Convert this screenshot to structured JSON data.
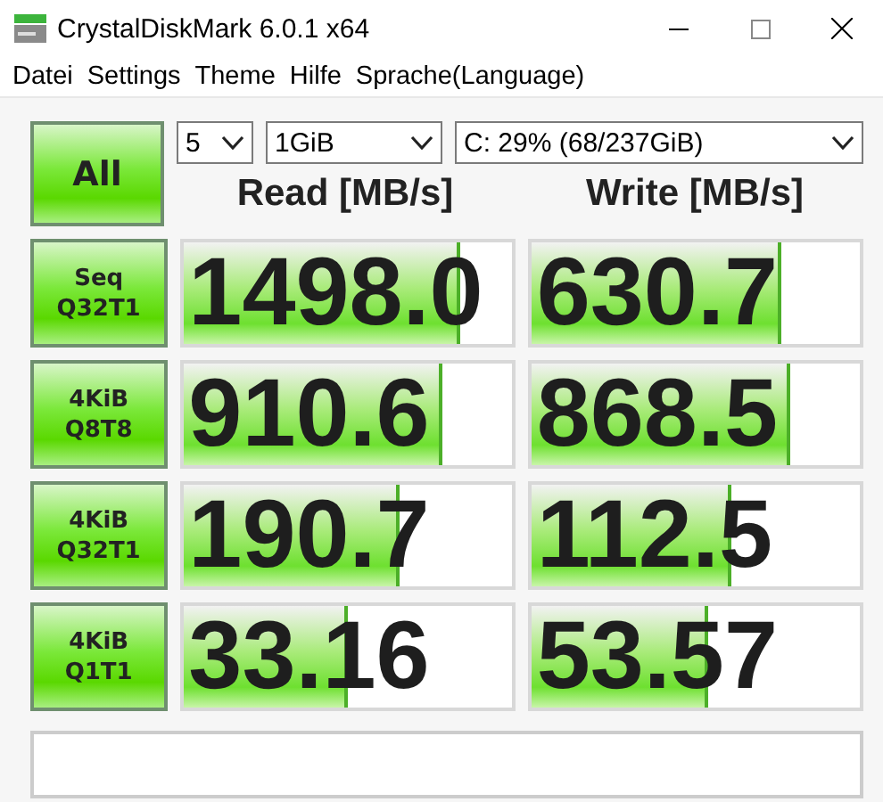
{
  "window": {
    "title": "CrystalDiskMark 6.0.1 x64"
  },
  "menu": [
    "Datei",
    "Settings",
    "Theme",
    "Hilfe",
    "Sprache(Language)"
  ],
  "all_button": {
    "label": "All"
  },
  "selects": [
    {
      "value": "5"
    },
    {
      "value": "1GiB"
    },
    {
      "value": "C: 29% (68/237GiB)"
    }
  ],
  "columns": [
    "Read [MB/s]",
    "Write [MB/s]"
  ],
  "rows": [
    {
      "test": [
        "Seq",
        "Q32T1"
      ],
      "read": {
        "value": "1498.0",
        "level": 0.83
      },
      "write": {
        "value": "630.7",
        "level": 0.75
      }
    },
    {
      "test": [
        "4KiB",
        "Q8T8"
      ],
      "read": {
        "value": "910.6",
        "level": 0.78
      },
      "write": {
        "value": "868.5",
        "level": 0.78
      }
    },
    {
      "test": [
        "4KiB",
        "Q32T1"
      ],
      "read": {
        "value": "190.7",
        "level": 0.65
      },
      "write": {
        "value": "112.5",
        "level": 0.6
      }
    },
    {
      "test": [
        "4KiB",
        "Q1T1"
      ],
      "read": {
        "value": "33.16",
        "level": 0.49
      },
      "write": {
        "value": "53.57",
        "level": 0.53
      }
    }
  ]
}
